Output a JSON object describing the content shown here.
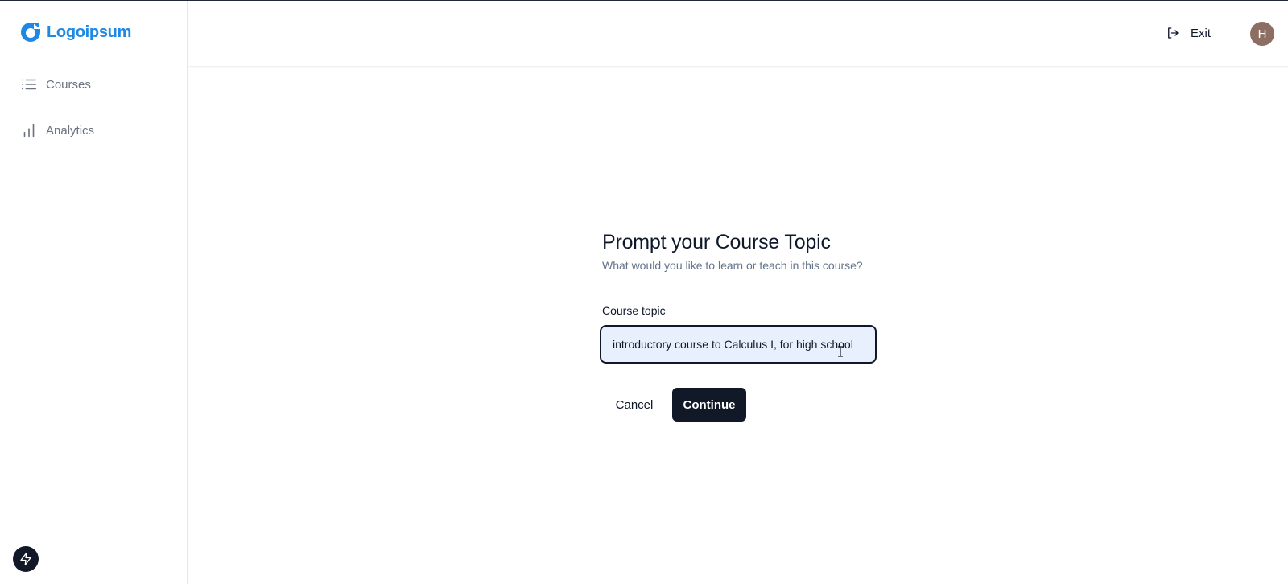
{
  "app": {
    "logo_text": "Logoipsum",
    "brand_color": "#1e88e5"
  },
  "sidebar": {
    "items": [
      {
        "label": "Courses",
        "icon": "list-icon"
      },
      {
        "label": "Analytics",
        "icon": "bar-chart-icon"
      }
    ],
    "bottom_button_icon": "bolt-icon"
  },
  "header": {
    "exit_label": "Exit",
    "exit_icon": "log-out-icon",
    "avatar_initial": "H",
    "avatar_color": "#8d6e63"
  },
  "form": {
    "title": "Prompt your Course Topic",
    "subtitle": "What would you like to learn or teach in this course?",
    "field_label": "Course topic",
    "field_value": "introductory course to Calculus I, for high school",
    "cancel_label": "Cancel",
    "continue_label": "Continue",
    "primary_color": "#111827"
  }
}
